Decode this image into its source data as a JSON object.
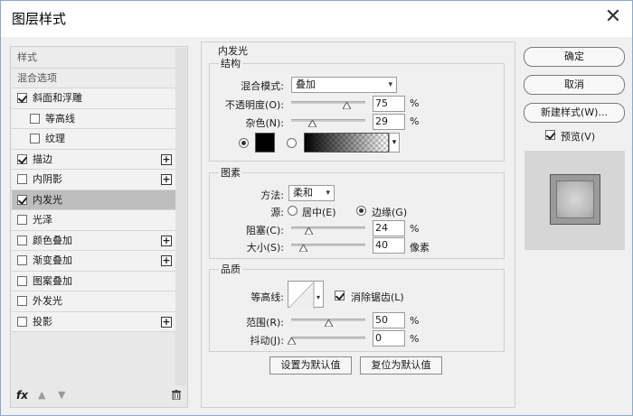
{
  "window": {
    "title": "图层样式"
  },
  "left_panel": {
    "header_styles": "样式",
    "header_blend": "混合选项",
    "items": [
      {
        "label": "斜面和浮雕",
        "checked": true,
        "plus": false,
        "indent": 0
      },
      {
        "label": "等高线",
        "checked": false,
        "plus": false,
        "indent": 1
      },
      {
        "label": "纹理",
        "checked": false,
        "plus": false,
        "indent": 1
      },
      {
        "label": "描边",
        "checked": true,
        "plus": true,
        "indent": 0
      },
      {
        "label": "内阴影",
        "checked": false,
        "plus": true,
        "indent": 0
      },
      {
        "label": "内发光",
        "checked": true,
        "plus": false,
        "indent": 0,
        "selected": true
      },
      {
        "label": "光泽",
        "checked": false,
        "plus": false,
        "indent": 0
      },
      {
        "label": "颜色叠加",
        "checked": false,
        "plus": true,
        "indent": 0
      },
      {
        "label": "渐变叠加",
        "checked": false,
        "plus": true,
        "indent": 0
      },
      {
        "label": "图案叠加",
        "checked": false,
        "plus": false,
        "indent": 0
      },
      {
        "label": "外发光",
        "checked": false,
        "plus": false,
        "indent": 0
      },
      {
        "label": "投影",
        "checked": false,
        "plus": true,
        "indent": 0
      }
    ],
    "fx_label": "fx",
    "plus_glyph": "+"
  },
  "inner_glow": {
    "section_title": "内发光",
    "structure": {
      "group_label": "结构",
      "blend_mode_label": "混合模式:",
      "blend_mode_value": "叠加",
      "opacity_label": "不透明度(O):",
      "opacity_value": "75",
      "opacity_pct": 75,
      "noise_label": "杂色(N):",
      "noise_value": "29",
      "noise_pct": 29,
      "unit_pct": "%",
      "color": "#000000"
    },
    "elements": {
      "group_label": "图素",
      "method_label": "方法:",
      "method_value": "柔和",
      "source_label": "源:",
      "source_center": "居中(E)",
      "source_edge": "边缘(G)",
      "choke_label": "阻塞(C):",
      "choke_value": "24",
      "choke_pct": 24,
      "size_label": "大小(S):",
      "size_value": "40",
      "size_fraction": 0.16,
      "unit_pct": "%",
      "unit_px": "像素"
    },
    "quality": {
      "group_label": "品质",
      "contour_label": "等高线:",
      "antialias_label": "消除锯齿(L)",
      "antialias_checked": true,
      "range_label": "范围(R):",
      "range_value": "50",
      "range_pct": 50,
      "jitter_label": "抖动(J):",
      "jitter_value": "0",
      "jitter_pct": 0,
      "unit_pct": "%"
    },
    "set_default": "设置为默认值",
    "reset_default": "复位为默认值"
  },
  "right_panel": {
    "ok": "确定",
    "cancel": "取消",
    "new_style": "新建样式(W)...",
    "preview_label": "预览(V)",
    "preview_checked": true
  },
  "colors": {
    "dialog_bg": "#f0f0f0",
    "selected_row": "#bdbdbd",
    "border": "#cfcfcf"
  },
  "icons": {
    "close": "close-icon",
    "up": "arrow-up-icon",
    "down": "arrow-down-icon",
    "trash": "trash-icon",
    "dropdown": "chevron-down-icon"
  }
}
